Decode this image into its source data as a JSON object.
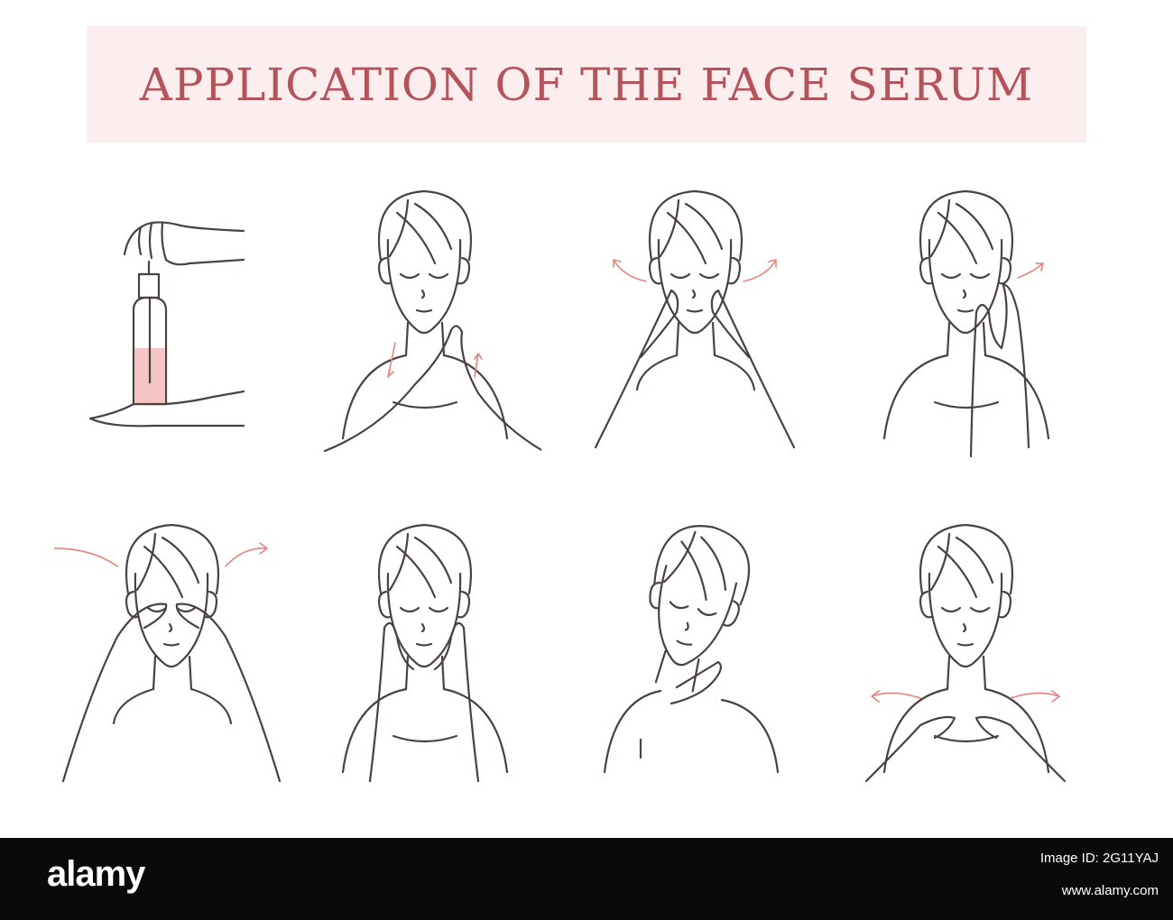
{
  "title": "APPLICATION OF THE FACE SERUM",
  "colors": {
    "banner": "#fcedef",
    "title": "#b4545a",
    "line": "#4b4044",
    "arrow": "#e3847e",
    "serum": "#f5c4c5"
  },
  "steps": [
    {
      "id": "dispense-serum",
      "icon": "serum-dropper-bottle"
    },
    {
      "id": "neck-upward-strokes",
      "icon": "palms-on-neck"
    },
    {
      "id": "cheeks-outward",
      "icon": "fingers-on-cheeks"
    },
    {
      "id": "under-eye-outward",
      "icon": "finger-under-eye"
    },
    {
      "id": "eyes-and-temples",
      "icon": "palms-over-eyes"
    },
    {
      "id": "cheeks-press",
      "icon": "palms-on-cheeks"
    },
    {
      "id": "side-of-neck",
      "icon": "hand-on-neck"
    },
    {
      "id": "decollete-outward",
      "icon": "hands-on-chest"
    }
  ],
  "watermark": {
    "brand": "alamy",
    "image_id": "Image ID: 2G11YAJ",
    "url": "www.alamy.com"
  }
}
